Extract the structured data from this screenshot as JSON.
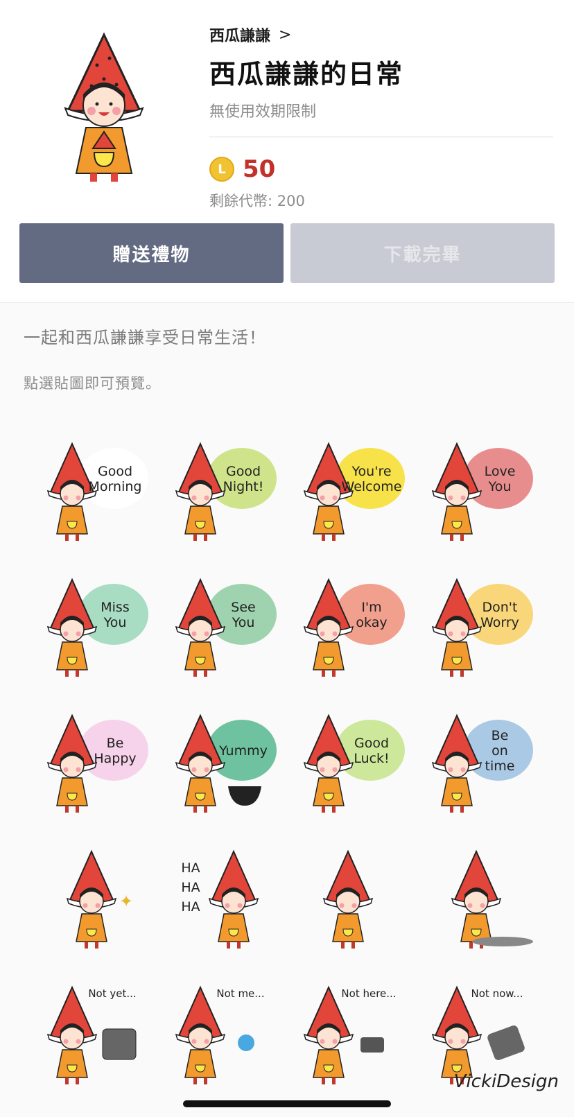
{
  "product": {
    "author": "西瓜謙謙",
    "chevron": ">",
    "title": "西瓜謙謙的日常",
    "validity": "無使用效期限制",
    "coin_letter": "L",
    "price": "50",
    "balance": "剩餘代幣: 200"
  },
  "actions": {
    "gift_label": "贈送禮物",
    "download_label": "下載完畢"
  },
  "description": "一起和西瓜謙謙享受日常生活！",
  "hint": "點選貼圖即可預覽。",
  "stickers": [
    {
      "lines": [
        "Good",
        "Morning"
      ],
      "bubble": "#ffffff",
      "prop": "sunflower"
    },
    {
      "lines": [
        "Good",
        "Night!"
      ],
      "bubble": "#cfe38a",
      "prop": "book"
    },
    {
      "lines": [
        "You're",
        "Welcome"
      ],
      "bubble": "#f7e24a",
      "prop": "none"
    },
    {
      "lines": [
        "Love",
        "You"
      ],
      "bubble": "#e88d8d",
      "prop": "none"
    },
    {
      "lines": [
        "Miss",
        "You"
      ],
      "bubble": "#a8dcc3",
      "prop": "none"
    },
    {
      "lines": [
        "See",
        "You"
      ],
      "bubble": "#9fd3b0",
      "prop": "none"
    },
    {
      "lines": [
        "I'm",
        "okay"
      ],
      "bubble": "#f0a08c",
      "prop": "notes"
    },
    {
      "lines": [
        "Don't",
        "Worry"
      ],
      "bubble": "#f9d67a",
      "prop": "none"
    },
    {
      "lines": [
        "Be",
        "Happy"
      ],
      "bubble": "#f6d3ea",
      "prop": "hearts"
    },
    {
      "lines": [
        "Yummy"
      ],
      "bubble": "#6fc2a0",
      "prop": "bowl"
    },
    {
      "lines": [
        "Good",
        "Luck!"
      ],
      "bubble": "#cde89a",
      "prop": "flowers"
    },
    {
      "lines": [
        "Be",
        "on",
        "time"
      ],
      "bubble": "#a9c9e4",
      "prop": "glasses"
    },
    {
      "lines": [],
      "bubble": "none",
      "prop": "sparkle"
    },
    {
      "lines": [
        "HA",
        "HA",
        "HA"
      ],
      "bubble": "none",
      "prop": "laugh"
    },
    {
      "lines": [],
      "bubble": "none",
      "prop": "stand"
    },
    {
      "lines": [],
      "bubble": "none",
      "prop": "shadow"
    },
    {
      "lines": [
        "Not yet..."
      ],
      "bubble": "none",
      "prop": "toaster"
    },
    {
      "lines": [
        "Not me..."
      ],
      "bubble": "none",
      "prop": "drops"
    },
    {
      "lines": [
        "Not here..."
      ],
      "bubble": "none",
      "prop": "phone"
    },
    {
      "lines": [
        "Not now..."
      ],
      "bubble": "none",
      "prop": "scale"
    }
  ],
  "watermark": "VickiDesign",
  "colors": {
    "gift_button": "#636b82",
    "done_button": "#c8cbd3",
    "price_red": "#c2322b",
    "coin_gold": "#f1c232"
  }
}
